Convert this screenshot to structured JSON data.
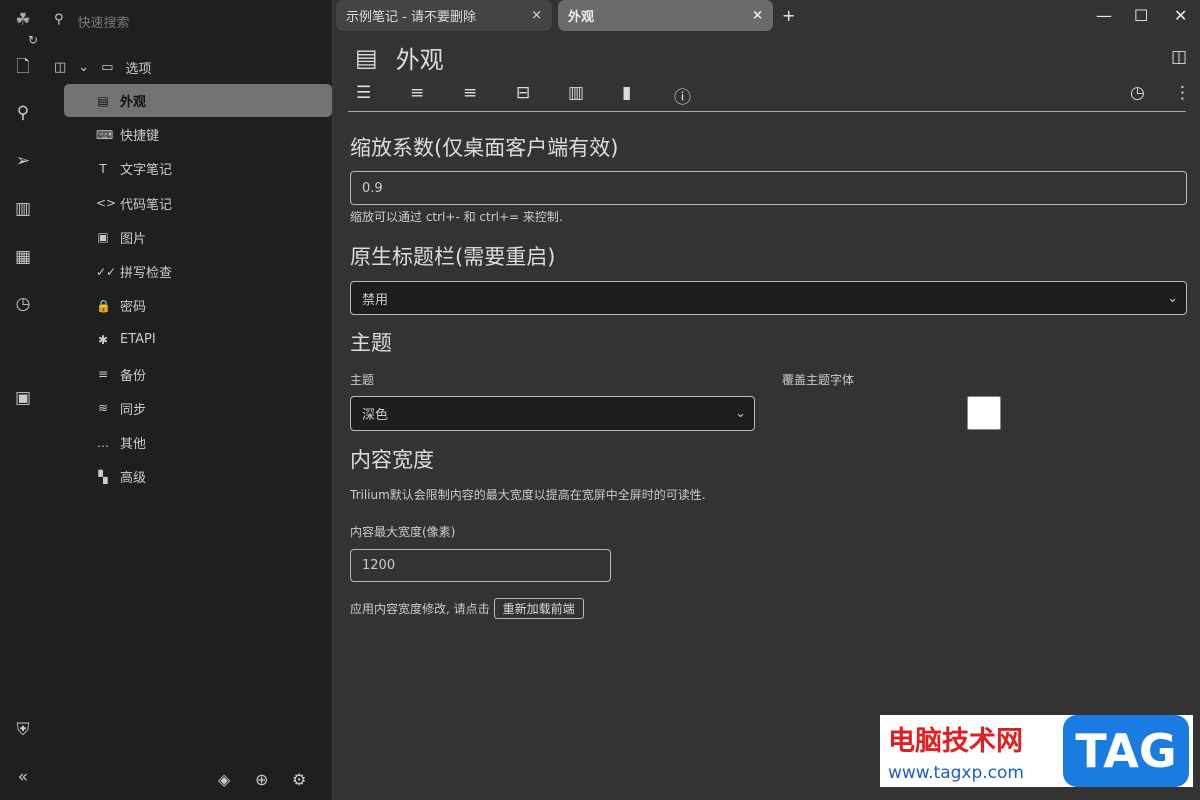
{
  "launcher": {
    "icons": [
      "trilium-logo-icon",
      "sync-icon",
      "new-note-icon",
      "search-icon",
      "jump-to-note-icon",
      "note-map-icon",
      "calendar-icon",
      "recent-changes-icon",
      "today-note-icon",
      "protected-session-icon",
      "collapse-sidebar-icon"
    ]
  },
  "tree": {
    "search_placeholder": "快速搜索",
    "root": "选项",
    "items": [
      {
        "label": "外观",
        "icon": "▤",
        "active": true
      },
      {
        "label": "快捷键",
        "icon": "⌨"
      },
      {
        "label": "文字笔记",
        "icon": "T"
      },
      {
        "label": "代码笔记",
        "icon": "<>"
      },
      {
        "label": "图片",
        "icon": "▣"
      },
      {
        "label": "拼写检查",
        "icon": "✓✓"
      },
      {
        "label": "密码",
        "icon": "🔒"
      },
      {
        "label": "ETAPI",
        "icon": "✱"
      },
      {
        "label": "备份",
        "icon": "≡"
      },
      {
        "label": "同步",
        "icon": "≋"
      },
      {
        "label": "其他",
        "icon": "…"
      },
      {
        "label": "高级",
        "icon": "▚"
      }
    ]
  },
  "tabs": [
    {
      "label": "示例笔记 - 请不要删除"
    },
    {
      "label": "外观"
    }
  ],
  "note": {
    "title": "外观"
  },
  "settings": {
    "zoom": {
      "heading": "缩放系数(仅桌面客户端有效)",
      "value": "0.9",
      "help": "缩放可以通过 ctrl+- 和 ctrl+= 来控制."
    },
    "titlebar": {
      "heading": "原生标题栏(需要重启)",
      "value": "禁用"
    },
    "theme": {
      "heading": "主题",
      "label": "主题",
      "value": "深色",
      "override_label": "覆盖主题字体"
    },
    "width": {
      "heading": "内容宽度",
      "desc": "Trilium默认会限制内容的最大宽度以提高在宽屏中全屏时的可读性.",
      "label": "内容最大宽度(像素)",
      "value": "1200",
      "apply_text": "应用内容宽度修改, 请点击",
      "reload_button": "重新加载前端"
    }
  },
  "watermark": {
    "text": "电脑技术网",
    "tag": "TAG",
    "url": "www.tagxp.com"
  }
}
